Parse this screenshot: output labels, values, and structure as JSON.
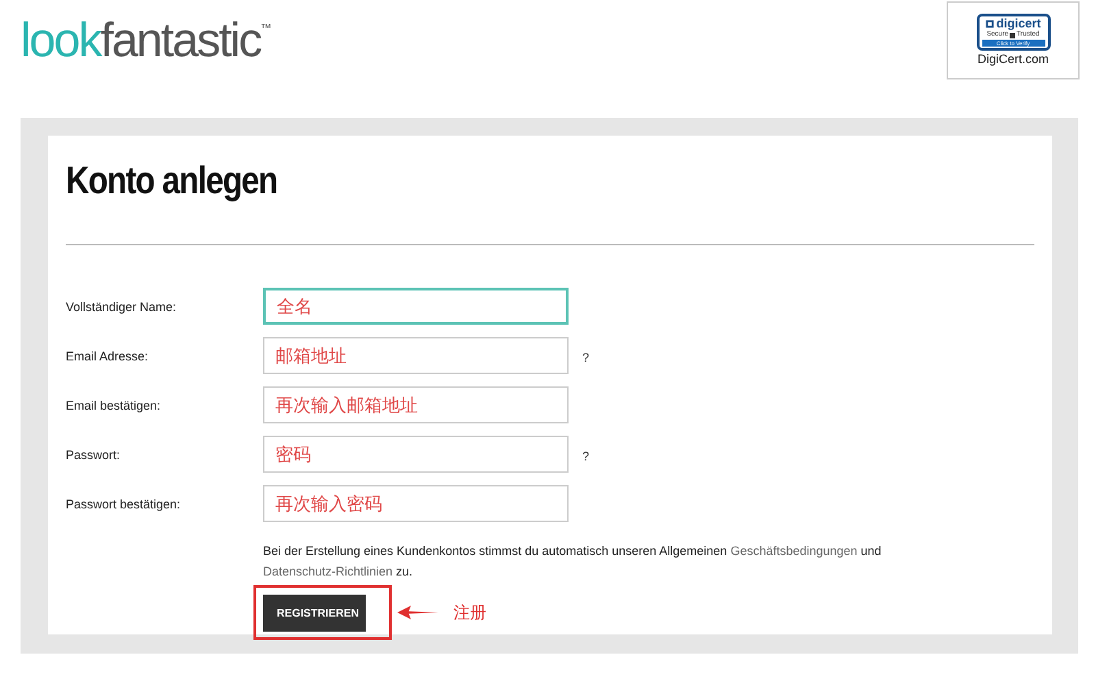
{
  "header": {
    "logo": {
      "first": "look",
      "second": "fantastic",
      "mark": "™"
    },
    "seal": {
      "brand": "digicert",
      "secure": "Secure",
      "trusted": "Trusted",
      "verify": "Click to Verify",
      "caption": "DigiCert.com"
    }
  },
  "form": {
    "title": "Konto anlegen",
    "fields": [
      {
        "label": "Vollständiger Name:",
        "value": "全名",
        "focused": true
      },
      {
        "label": "Email Adresse:",
        "value": "邮箱地址",
        "focused": false,
        "help": "?"
      },
      {
        "label": "Email bestätigen:",
        "value": "再次输入邮箱地址",
        "focused": false
      },
      {
        "label": "Passwort:",
        "value": "密码",
        "focused": false,
        "help": "?"
      },
      {
        "label": "Passwort bestätigen:",
        "value": "再次输入密码",
        "focused": false
      }
    ],
    "consent": {
      "before": "Bei der Erstellung eines Kundenkontos stimmst du automatisch unseren Allgemeinen ",
      "link_1": "Geschäftsbedingungen",
      "middle": " und ",
      "link_2": "Datenschutz-Richtlinien",
      "after": " zu."
    },
    "submit": "REGISTRIEREN",
    "annotation": "注册"
  }
}
